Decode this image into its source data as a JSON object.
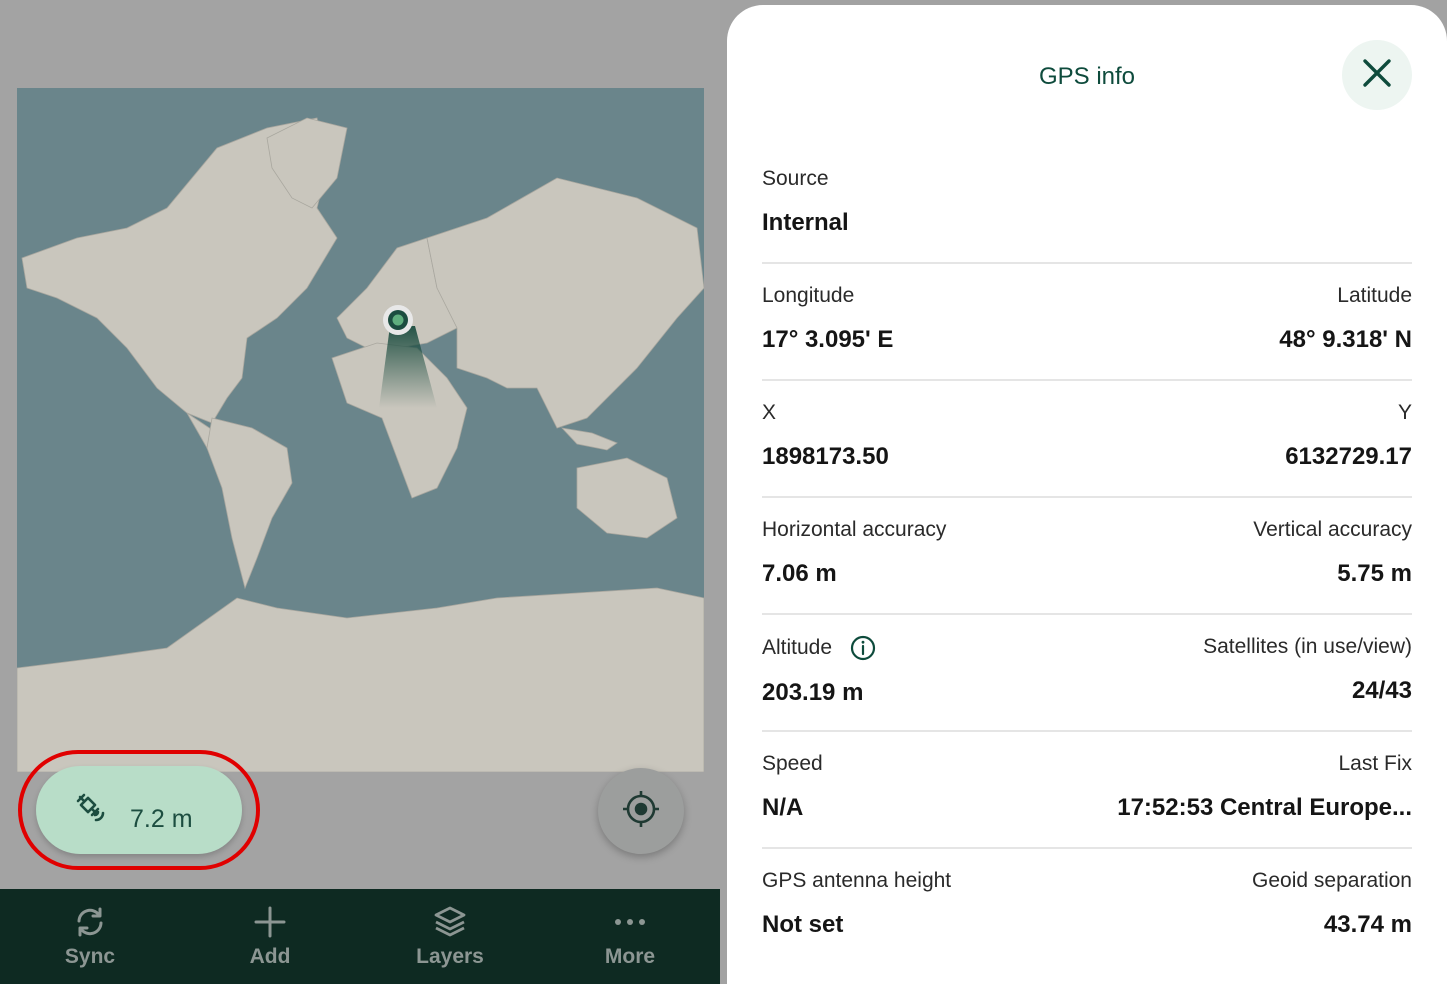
{
  "map": {
    "accuracy_label": "7.2 m"
  },
  "nav": {
    "items": [
      {
        "label": "Sync",
        "icon": "sync-icon"
      },
      {
        "label": "Add",
        "icon": "plus-icon"
      },
      {
        "label": "Layers",
        "icon": "layers-icon"
      },
      {
        "label": "More",
        "icon": "more-icon"
      }
    ]
  },
  "panel": {
    "title": "GPS info",
    "source": {
      "label": "Source",
      "value": "Internal"
    },
    "longitude": {
      "label": "Longitude",
      "value": "17° 3.095' E"
    },
    "latitude": {
      "label": "Latitude",
      "value": "48° 9.318' N"
    },
    "x": {
      "label": "X",
      "value": "1898173.50"
    },
    "y": {
      "label": "Y",
      "value": "6132729.17"
    },
    "horizontal_accuracy": {
      "label": "Horizontal accuracy",
      "value": "7.06 m"
    },
    "vertical_accuracy": {
      "label": "Vertical accuracy",
      "value": "5.75 m"
    },
    "altitude": {
      "label": "Altitude",
      "value": "203.19 m"
    },
    "satellites": {
      "label": "Satellites (in use/view)",
      "value": "24/43"
    },
    "speed": {
      "label": "Speed",
      "value": "N/A"
    },
    "last_fix": {
      "label": "Last Fix",
      "value": "17:52:53 Central Europe..."
    },
    "antenna_height": {
      "label": "GPS antenna height",
      "value": "Not set"
    },
    "geoid_separation": {
      "label": "Geoid separation",
      "value": "43.74 m"
    }
  },
  "colors": {
    "accent": "#0e4b3c",
    "accuracy_chip": "#b8ddc8",
    "highlight": "#e00000",
    "nav_bg": "#0e2a22"
  }
}
